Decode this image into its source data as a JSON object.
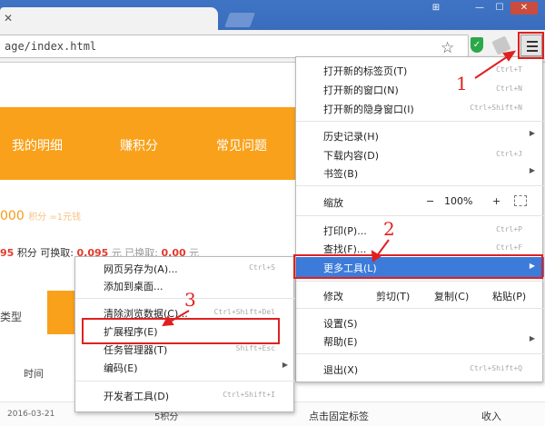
{
  "browser": {
    "tab_close": "✕",
    "window_controls": [
      "⊞",
      "—",
      "☐",
      "✕"
    ],
    "url": "age/index.html",
    "star": "☆",
    "shield": "✓"
  },
  "page": {
    "nav": [
      "我的明细",
      "赚积分",
      "常见问题"
    ],
    "points_big": "000",
    "points_sub": "积分 =1元钱",
    "row2": {
      "prefix": "95",
      "label": "积分 可换取:",
      "value1": "0.095",
      "label2": "元 已换取:",
      "value2": "0.00",
      "unit": "元"
    },
    "type_label": "类型",
    "time_label": "时间",
    "footer": {
      "date": "2016-03-21",
      "points": "5积分",
      "pin_tab": "点击固定标签",
      "income": "收入"
    }
  },
  "main_menu": {
    "items": [
      {
        "label": "打开新的标签页(T)",
        "shortcut": "Ctrl+T"
      },
      {
        "label": "打开新的窗口(N)",
        "shortcut": "Ctrl+N"
      },
      {
        "label": "打开新的隐身窗口(I)",
        "shortcut": "Ctrl+Shift+N"
      },
      {
        "label": "历史记录(H)",
        "arrow": "▶"
      },
      {
        "label": "下载内容(D)",
        "shortcut": "Ctrl+J"
      },
      {
        "label": "书签(B)",
        "arrow": "▶"
      },
      {
        "label": "缩放",
        "minus": "−",
        "value": "100%",
        "plus": "+"
      },
      {
        "label": "打印(P)...",
        "shortcut": "Ctrl+P"
      },
      {
        "label": "查找(F)...",
        "shortcut": "Ctrl+F"
      },
      {
        "label": "更多工具(L)",
        "arrow": "▶"
      },
      {
        "label": "修改",
        "cut": "剪切(T)",
        "copy": "复制(C)",
        "paste": "粘贴(P)"
      },
      {
        "label": "设置(S)"
      },
      {
        "label": "帮助(E)",
        "arrow": "▶"
      },
      {
        "label": "退出(X)",
        "shortcut": "Ctrl+Shift+Q"
      }
    ]
  },
  "sub_menu": {
    "items": [
      {
        "label": "网页另存为(A)...",
        "shortcut": "Ctrl+S"
      },
      {
        "label": "添加到桌面..."
      },
      {
        "label": "清除浏览数据(C)...",
        "shortcut": "Ctrl+Shift+Del"
      },
      {
        "label": "扩展程序(E)"
      },
      {
        "label": "任务管理器(T)",
        "shortcut": "Shift+Esc"
      },
      {
        "label": "编码(E)",
        "arrow": "▶"
      },
      {
        "label": "开发者工具(D)",
        "shortcut": "Ctrl+Shift+I"
      }
    ]
  },
  "annotations": {
    "step1": "1",
    "step2": "2",
    "step3": "3"
  },
  "colors": {
    "accent_orange": "#f9a11a",
    "highlight_blue": "#3c7bd9",
    "annotation_red": "#e02020"
  }
}
